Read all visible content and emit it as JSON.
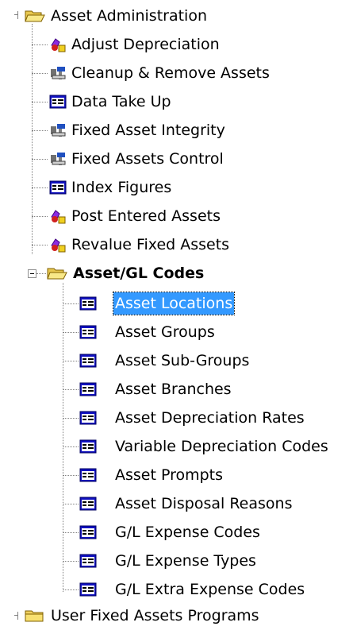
{
  "tree": {
    "root": {
      "label": "Asset Administration",
      "children": [
        {
          "label": "Adjust Depreciation",
          "icon": "utility-icon"
        },
        {
          "label": "Cleanup & Remove Assets",
          "icon": "tools-icon"
        },
        {
          "label": "Data Take Up",
          "icon": "form-icon"
        },
        {
          "label": "Fixed Asset Integrity",
          "icon": "tools-icon"
        },
        {
          "label": "Fixed Assets Control",
          "icon": "tools-icon"
        },
        {
          "label": "Index Figures",
          "icon": "form-icon"
        },
        {
          "label": "Post Entered Assets",
          "icon": "utility-icon"
        },
        {
          "label": "Revalue Fixed Assets",
          "icon": "utility-icon"
        }
      ]
    },
    "gl_folder": {
      "label": "Asset/GL Codes",
      "children": [
        {
          "label": "Asset Locations",
          "icon": "form-icon",
          "selected": true
        },
        {
          "label": "Asset Groups",
          "icon": "form-icon"
        },
        {
          "label": "Asset Sub-Groups",
          "icon": "form-icon"
        },
        {
          "label": "Asset Branches",
          "icon": "form-icon"
        },
        {
          "label": "Asset Depreciation Rates",
          "icon": "form-icon"
        },
        {
          "label": "Variable Depreciation Codes",
          "icon": "form-icon"
        },
        {
          "label": "Asset Prompts",
          "icon": "form-icon"
        },
        {
          "label": "Asset Disposal Reasons",
          "icon": "form-icon"
        },
        {
          "label": "G/L Expense Codes",
          "icon": "form-icon"
        },
        {
          "label": "G/L Expense Types",
          "icon": "form-icon"
        },
        {
          "label": "G/L Extra Expense Codes",
          "icon": "form-icon"
        }
      ]
    },
    "user_folder": {
      "label": "User Fixed Assets Programs"
    }
  },
  "colors": {
    "selection": "#3399ff",
    "folder": "#f0d060",
    "form_icon_blue": "#1010c0"
  }
}
